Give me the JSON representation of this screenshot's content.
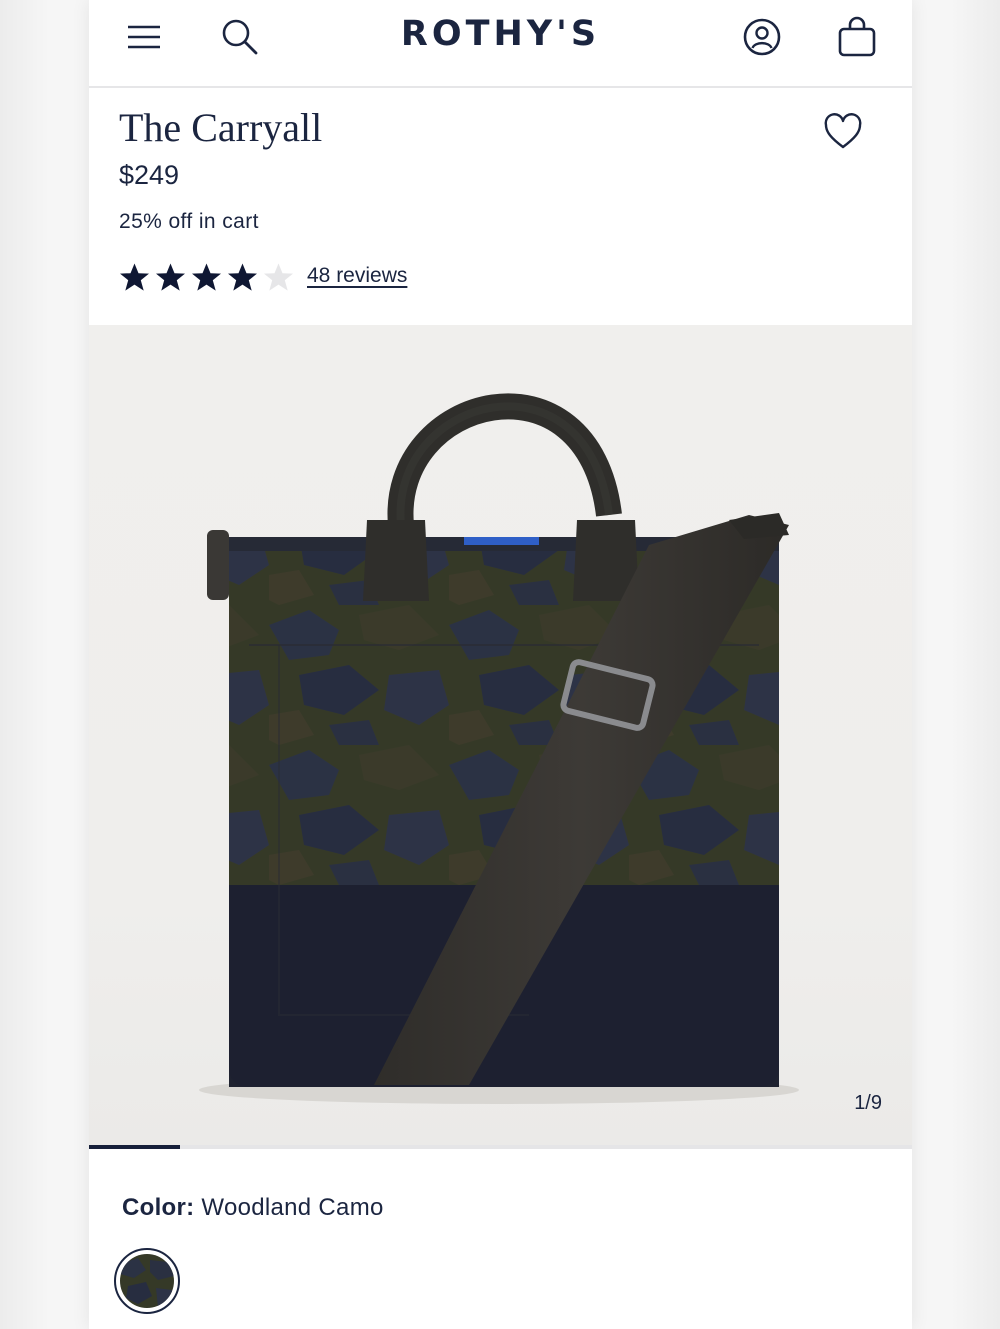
{
  "header": {
    "brand": "ROTHY'S",
    "menu_icon": "hamburger-menu-icon",
    "search_icon": "search-icon",
    "account_icon": "account-icon",
    "bag_icon": "shopping-bag-icon"
  },
  "product": {
    "title": "The Carryall",
    "price": "$249",
    "promo": "25% off in cart",
    "rating": 4,
    "rating_max": 5,
    "reviews_label": "48 reviews",
    "favorite_icon": "heart-icon"
  },
  "gallery": {
    "counter": "1/9",
    "current": 1,
    "total": 9
  },
  "color": {
    "label": "Color:",
    "value": "Woodland Camo"
  },
  "colors": {
    "brand": "#1b2540",
    "star_filled": "#0f1733",
    "star_empty": "#e6e6e8"
  }
}
